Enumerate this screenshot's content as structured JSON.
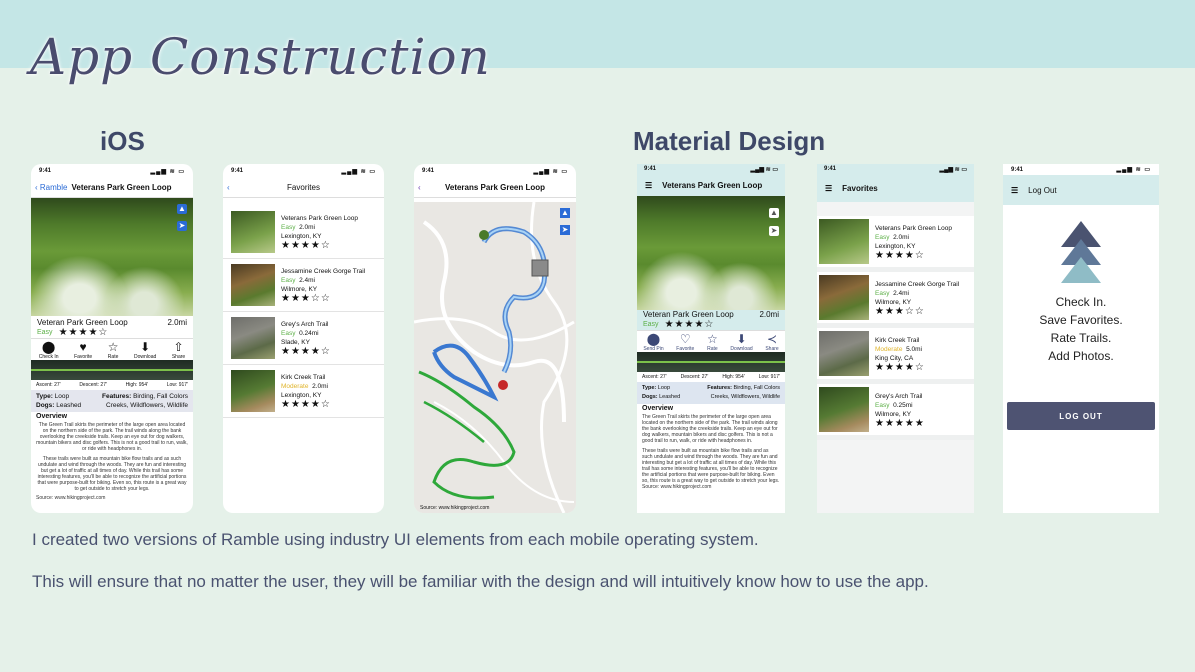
{
  "title": "App Construction",
  "sections": {
    "ios": "iOS",
    "material": "Material Design"
  },
  "description": [
    "I created two versions of Ramble using industry UI elements from each mobile operating system.",
    "This will ensure that no matter the user, they will be familiar with the design and will intuitively know how to use the app."
  ],
  "status_time": "9:41",
  "status_icons": "▂▄▆ ≋ ▭",
  "trail": {
    "back_label": "Ramble",
    "name": "Veterans Park Green Loop",
    "short_name": "Veteran Park Green Loop",
    "distance": "2.0mi",
    "difficulty": "Easy",
    "stars": "★★★★☆",
    "ios_actions": [
      {
        "icon": "pin-icon",
        "glyph": "⬤",
        "label": "Check In"
      },
      {
        "icon": "heart-icon",
        "glyph": "♥",
        "label": "Favorite"
      },
      {
        "icon": "star-icon",
        "glyph": "☆",
        "label": "Rate"
      },
      {
        "icon": "download-icon",
        "glyph": "⬇",
        "label": "Download"
      },
      {
        "icon": "share-icon",
        "glyph": "⇧",
        "label": "Share"
      }
    ],
    "md_actions": [
      {
        "icon": "pin-icon",
        "glyph": "⬤",
        "label": "Send Pin"
      },
      {
        "icon": "heart-icon",
        "glyph": "♡",
        "label": "Favorite"
      },
      {
        "icon": "star-icon",
        "glyph": "☆",
        "label": "Rate"
      },
      {
        "icon": "download-icon",
        "glyph": "⬇",
        "label": "Download"
      },
      {
        "icon": "share-icon",
        "glyph": "≺",
        "label": "Share"
      }
    ],
    "stats": {
      "ascent": "Ascent: 27'",
      "descent": "Descent: 27'",
      "high": "High: 954'",
      "low": "Low: 917'"
    },
    "type_label": "Type:",
    "type": "Loop",
    "dogs_label": "Dogs:",
    "dogs": "Leashed",
    "features_label": "Features:",
    "features_1": "Birding, Fall Colors",
    "features_2": "Creeks, Wildflowers, Wildlife",
    "overview_title": "Overview",
    "overview_p1": "The Green Trail skirts the perimeter of the large open area located on the northern side of the park. The trail winds along the bank overlooking the creekside trails. Keep an eye out for dog walkers, mountain bikers and disc golfers. This is not a good trail to run, walk, or ride with headphones in.",
    "overview_p2": "These trails were built as mountain bike flow trails and as such undulate and wind through the woods. They are fun and interesting but get a lot of traffic at all times of day. While this trail has some interesting features, you'll be able to recognize the artificial portions that were purpose-built for biking. Even so, this route is a great way to get outside to stretch your legs.",
    "source": "Source: www.hikingproject.com"
  },
  "favorites_title": "Favorites",
  "favorites": [
    {
      "name": "Veterans Park Green Loop",
      "difficulty": "Easy",
      "distance": "2.0mi",
      "location": "Lexington, KY",
      "stars": "★★★★☆"
    },
    {
      "name": "Jessamine Creek Gorge Trail",
      "difficulty": "Easy",
      "distance": "2.4mi",
      "location": "Wilmore, KY",
      "stars": "★★★☆☆"
    },
    {
      "name": "Grey's Arch Trail",
      "difficulty": "Easy",
      "distance": "0.24mi",
      "location": "Slade, KY",
      "stars": "★★★★☆"
    },
    {
      "name": "Kirk Creek Trail",
      "difficulty": "Moderate",
      "distance": "2.0mi",
      "location": "Lexington, KY",
      "stars": "★★★★☆"
    }
  ],
  "md_favorites": [
    {
      "name": "Veterans Park Green Loop",
      "difficulty": "Easy",
      "distance": "2.0mi",
      "location": "Lexington, KY",
      "stars": "★★★★☆"
    },
    {
      "name": "Jessamine Creek Gorge Trail",
      "difficulty": "Easy",
      "distance": "2.4mi",
      "location": "Wilmore, KY",
      "stars": "★★★☆☆"
    },
    {
      "name": "Kirk Creek Trail",
      "difficulty": "Moderate",
      "distance": "5.0mi",
      "location": "King City, CA",
      "stars": "★★★★☆"
    },
    {
      "name": "Grey's Arch Trail",
      "difficulty": "Easy",
      "distance": "0.25mi",
      "location": "Wilmore, KY",
      "stars": "★★★★★"
    }
  ],
  "map_source": "Source: www.hikingproject.com",
  "logout": {
    "title": "Log Out",
    "lines": [
      "Check In.",
      "Save Favorites.",
      "Rate Trails.",
      "Add Photos."
    ],
    "button": "LOG OUT"
  },
  "colors": {
    "band": "#c4e6e6",
    "background": "#e5f1e9",
    "heading": "#3e4868",
    "button": "#4e5372",
    "easy": "#5db048",
    "moderate": "#e0b42a"
  }
}
